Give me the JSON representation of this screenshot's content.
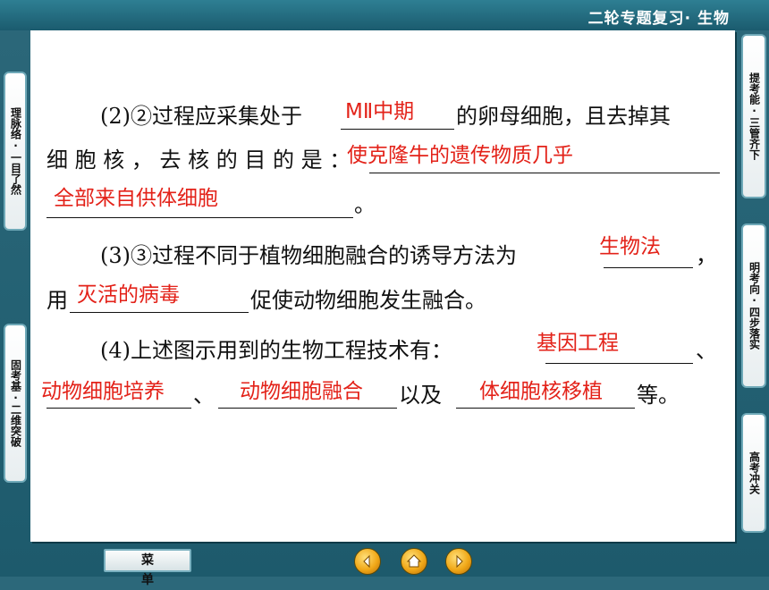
{
  "header": {
    "title": "二轮专题复习· 生物"
  },
  "left_tabs": [
    {
      "label": "理脉络·一目了然"
    },
    {
      "label": "固考基·二维突破"
    }
  ],
  "right_tabs": [
    {
      "label": "提考能·三管齐下"
    },
    {
      "label": "明考向·四步落实"
    },
    {
      "label": "高考冲关"
    }
  ],
  "content": {
    "q2_line1_prefix": "(2)②过程应采集处于",
    "q2_line1_suffix": "的卵母细胞，且去掉其",
    "q2_answer1": "MⅡ中期",
    "q2_line2_prefix": "细 胞 核 ， 去 核 的 目 的 是 ：",
    "q2_answer2a": "使克隆牛的遗传物质几乎",
    "q2_answer2b": "全部来自供体细胞",
    "q2_line3_end": "。",
    "q3_line1": "(3)③过程不同于植物细胞融合的诱导方法为",
    "q3_answer1": "生物法",
    "q3_line1_end": "，",
    "q3_line2_prefix": "用",
    "q3_answer2": "灭活的病毒",
    "q3_line2_suffix": "促使动物细胞发生融合。",
    "q4_line1": "(4)上述图示用到的生物工程技术有：",
    "q4_answer1": "基因工程",
    "q4_line1_end": "、",
    "q4_answer2": "动物细胞培养",
    "q4_sep1": "、",
    "q4_answer3": "动物细胞融合",
    "q4_sep2": "以及",
    "q4_answer4": "体细胞核移植",
    "q4_end": "等。"
  },
  "footer": {
    "menu_label": "菜单",
    "nav_icons": [
      "back-home-icon",
      "home-icon",
      "forward-icon"
    ]
  },
  "colors": {
    "answer": "#e32219",
    "background": "#1f5f72",
    "tab_border": "#6fa9b8"
  }
}
